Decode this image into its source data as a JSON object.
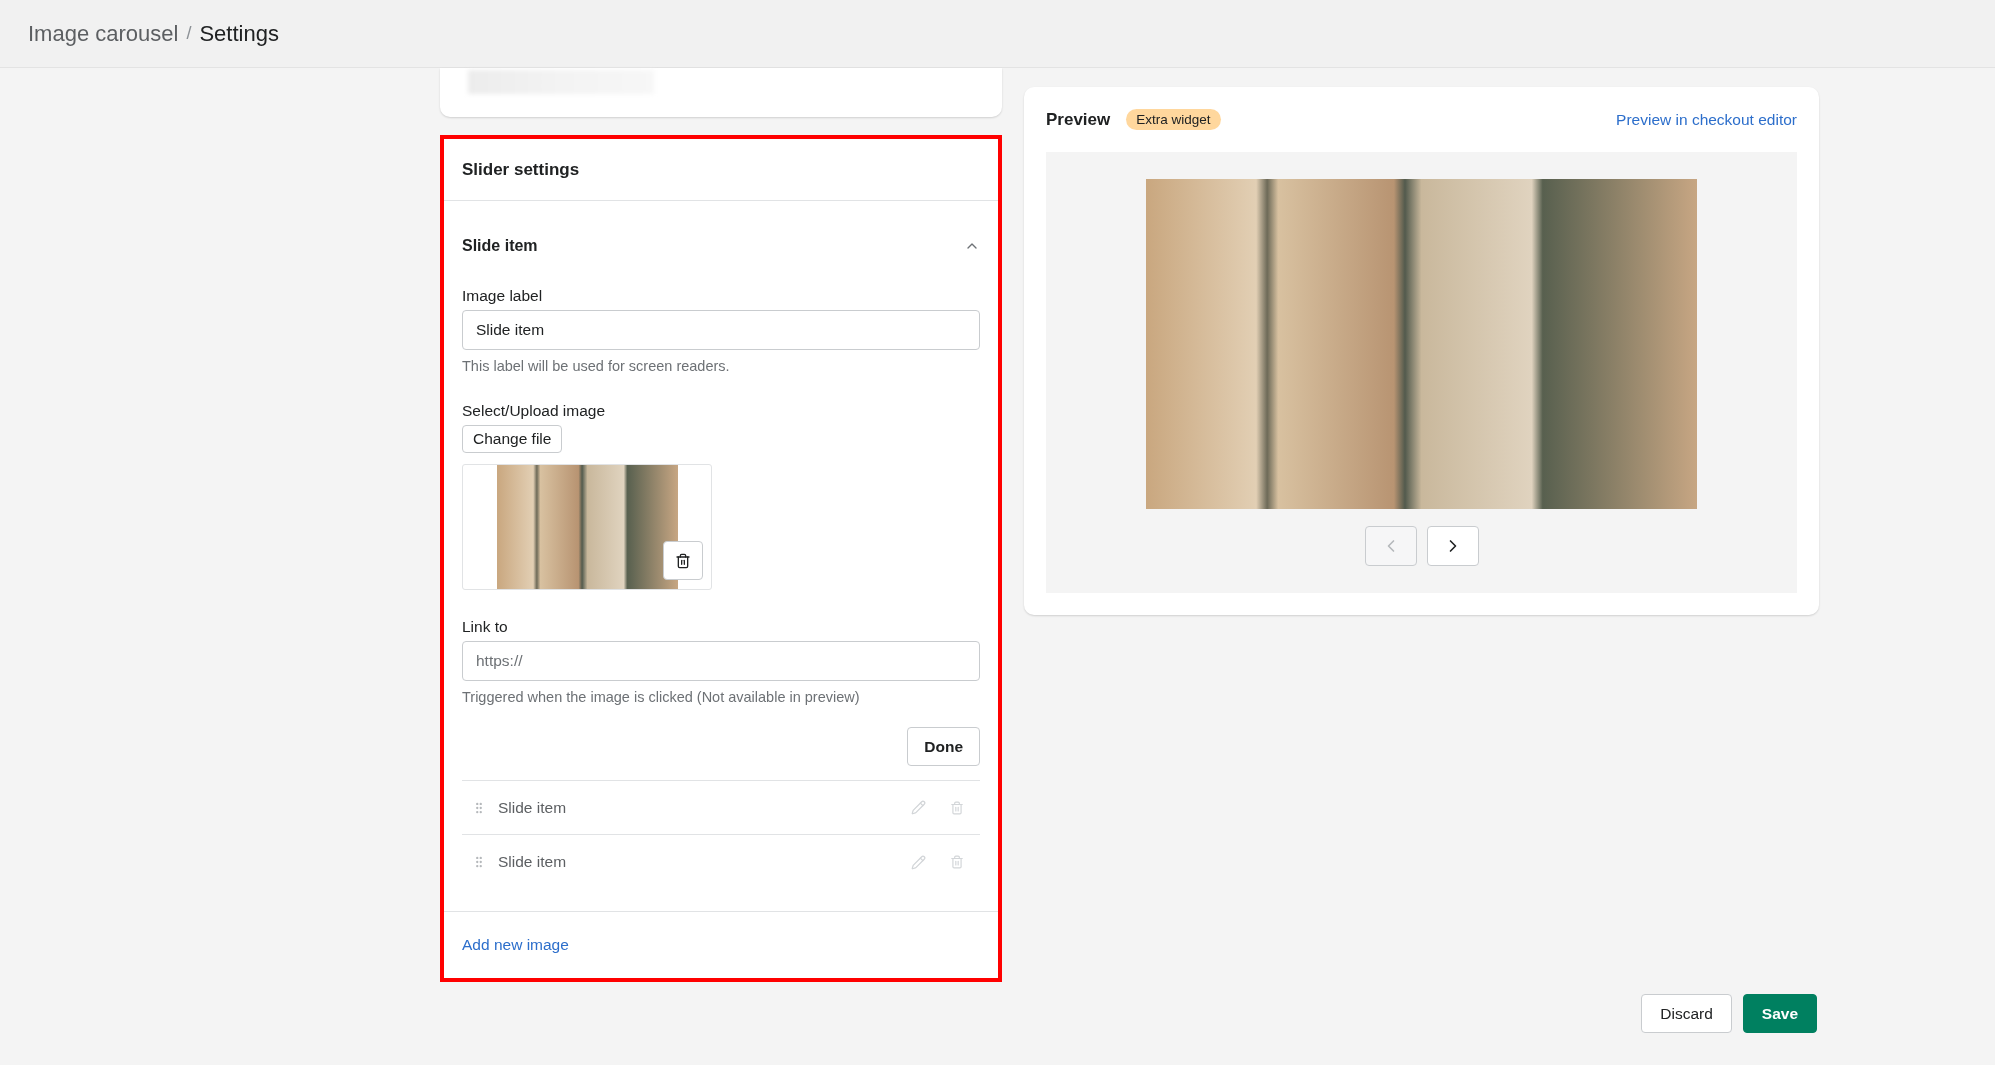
{
  "breadcrumb": {
    "parent": "Image carousel",
    "separator": "/",
    "current": "Settings"
  },
  "slider_settings": {
    "title": "Slider settings",
    "highlighted": true,
    "editor": {
      "title": "Slide item",
      "expanded": true,
      "image_label": {
        "label": "Image label",
        "value": "Slide item",
        "help": "This label will be used for screen readers."
      },
      "image": {
        "label": "Select/Upload image",
        "button": "Change file"
      },
      "link": {
        "label": "Link to",
        "placeholder": "https://",
        "help": "Triggered when the image is clicked (Not available in preview)"
      },
      "done_button": "Done"
    },
    "items": [
      {
        "label": "Slide item"
      },
      {
        "label": "Slide item"
      }
    ],
    "add_link": "Add new image"
  },
  "preview": {
    "title": "Preview",
    "badge": "Extra widget",
    "link": "Preview in checkout editor",
    "nav": [
      {
        "kind": "prev",
        "disabled": true
      },
      {
        "kind": "next",
        "disabled": false
      }
    ]
  },
  "actions": [
    {
      "label": "Discard",
      "kind": "secondary"
    },
    {
      "label": "Save",
      "kind": "primary"
    }
  ]
}
